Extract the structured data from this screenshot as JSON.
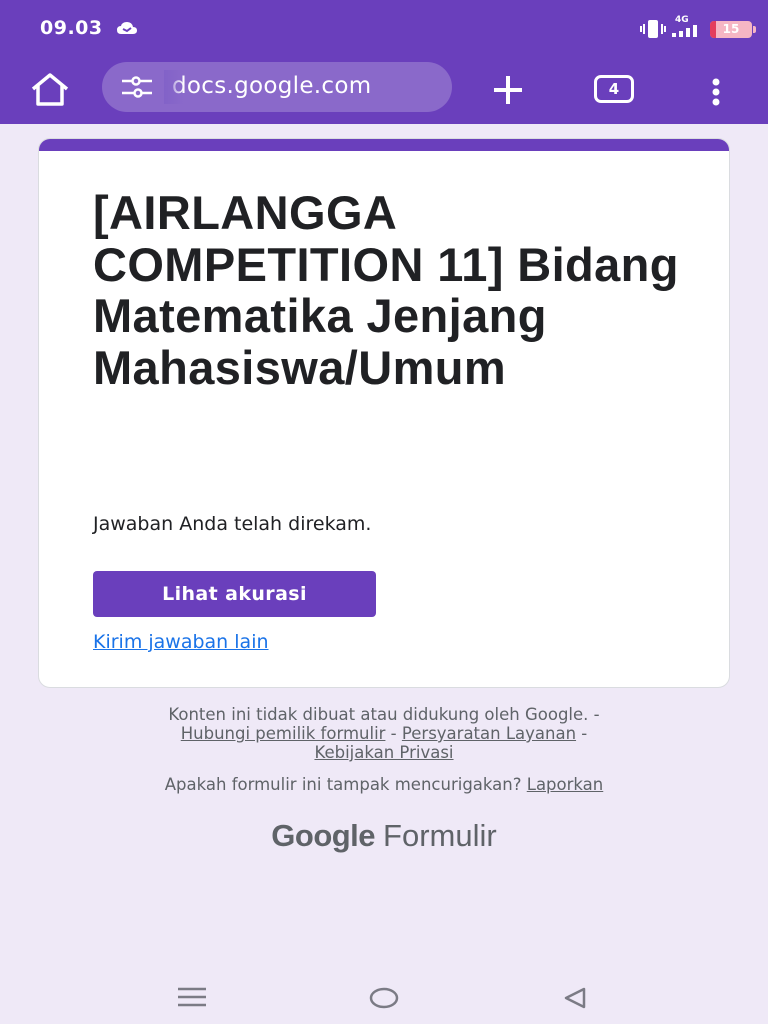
{
  "status_bar": {
    "time": "09.03",
    "network": "4G",
    "battery": "15",
    "battery_level": 0.15
  },
  "browser": {
    "url": "docs.google.com",
    "tab_count": "4"
  },
  "form": {
    "title": "[AIRLANGGA COMPETITION 11] Bidang Matematika Jenjang Mahasiswa/Umum",
    "confirmation": "Jawaban Anda telah direkam.",
    "view_accuracy_label": "Lihat akurasi",
    "submit_another_label": "Kirim jawaban lain"
  },
  "footer": {
    "disclaimer": "Konten ini tidak dibuat atau didukung oleh Google.",
    "sep1": " - ",
    "contact_owner": "Hubungi pemilik formulir",
    "sep2": " - ",
    "terms": "Persyaratan Layanan",
    "sep3": " - ",
    "privacy": "Kebijakan Privasi",
    "suspicious": "Apakah formulir ini tampak mencurigakan?",
    "report": "Laporkan",
    "brand_google": "Google",
    "brand_product": "Formulir"
  },
  "colors": {
    "accent": "#6a3fbc",
    "page_bg": "#efe9f7",
    "link": "#1a73e8",
    "battery_low": "#e43d5d"
  },
  "icons": [
    "cloud-icon",
    "vibrate-icon",
    "signal-icon",
    "battery-icon",
    "home-icon",
    "tune-icon",
    "plus-icon",
    "tabs-icon",
    "more-vert-icon",
    "recent-apps-icon",
    "nav-home-icon",
    "back-icon"
  ]
}
